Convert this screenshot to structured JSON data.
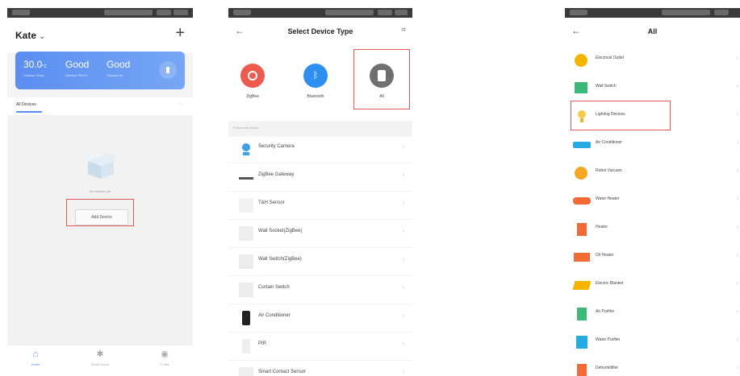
{
  "screen1": {
    "title": "Kate",
    "title_caret": "⌄",
    "add_icon": "plus-icon",
    "weather": [
      {
        "value": "30.0",
        "unit": "°C",
        "label": "Outdoor Temp."
      },
      {
        "value": "Good",
        "label": "Outdoor PM2.5"
      },
      {
        "value": "Good",
        "label": "Outdoor Air"
      }
    ],
    "tab_label": "All Devices",
    "tab_more": "···",
    "empty_text": "No devices yet",
    "add_device_label": "Add Device",
    "highlight_color": "#e05a5a",
    "accent_color": "#5b8ef0",
    "nav": [
      {
        "icon": "home-icon",
        "glyph": "⌂",
        "label": "Home"
      },
      {
        "icon": "smart-scene-icon",
        "glyph": "✱",
        "label": "Smart Scene"
      },
      {
        "icon": "profile-icon",
        "glyph": "◉",
        "label": "Profile"
      }
    ]
  },
  "screen2": {
    "back_icon": "back-arrow-icon",
    "title": "Select Device Type",
    "scan_icon": "scan-icon",
    "types": [
      {
        "label": "ZigBee",
        "icon": "zigbee-icon",
        "color": "#ef5a4e"
      },
      {
        "label": "Bluetooth",
        "icon": "bluetooth-icon",
        "color": "#2e8ff0"
      },
      {
        "label": "All",
        "icon": "all-devices-icon",
        "color": "#6f6f6f"
      }
    ],
    "section_label": "Frequently Added",
    "items": [
      {
        "label": "Security Camera",
        "icon": "security-camera-icon",
        "color": "#3aa0e8"
      },
      {
        "label": "ZigBee Gateway",
        "icon": "zigbee-gateway-icon",
        "color": "#555555"
      },
      {
        "label": "T&H Sensor",
        "icon": "th-sensor-icon",
        "color": "#dddddd"
      },
      {
        "label": "Wall Socket(ZigBee)",
        "icon": "wall-socket-icon",
        "color": "#dddddd"
      },
      {
        "label": "Wall Switch(ZigBee)",
        "icon": "wall-switch-icon",
        "color": "#e2e2e2"
      },
      {
        "label": "Curtain Switch",
        "icon": "curtain-switch-icon",
        "color": "#e6e6e6"
      },
      {
        "label": "Air Conditioner",
        "icon": "air-conditioner-icon",
        "color": "#222222"
      },
      {
        "label": "PIR",
        "icon": "pir-sensor-icon",
        "color": "#e6e6e6"
      },
      {
        "label": "Smart Contact Sensor",
        "icon": "contact-sensor-icon",
        "color": "#e6e6e6"
      }
    ]
  },
  "screen3": {
    "back_icon": "back-arrow-icon",
    "title": "All",
    "items": [
      {
        "label": "Electrical Outlet",
        "icon": "outlet-icon",
        "color": "#f5b400"
      },
      {
        "label": "Wall Switch",
        "icon": "wall-switch-icon",
        "color": "#3cb878"
      },
      {
        "label": "Lighting Devices",
        "icon": "lighting-icon",
        "color": "#f7c948"
      },
      {
        "label": "Air Conditioner",
        "icon": "air-conditioner-icon",
        "color": "#27a9e1"
      },
      {
        "label": "Robot Vacuum",
        "icon": "robot-vacuum-icon",
        "color": "#f5a623"
      },
      {
        "label": "Water Heater",
        "icon": "water-heater-icon",
        "color": "#f26a36"
      },
      {
        "label": "Heater",
        "icon": "heater-icon",
        "color": "#f26a36"
      },
      {
        "label": "Oil Heater",
        "icon": "oil-heater-icon",
        "color": "#f26a36"
      },
      {
        "label": "Electric Blanket",
        "icon": "electric-blanket-icon",
        "color": "#f5b400"
      },
      {
        "label": "Air Purifier",
        "icon": "air-purifier-icon",
        "color": "#3cb878"
      },
      {
        "label": "Water Purifier",
        "icon": "water-purifier-icon",
        "color": "#27a9e1"
      },
      {
        "label": "Dehumidifier",
        "icon": "dehumidifier-icon",
        "color": "#f26a36"
      }
    ]
  }
}
